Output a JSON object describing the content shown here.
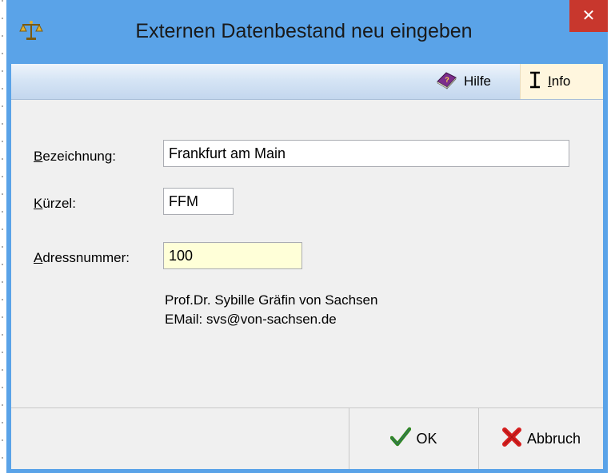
{
  "window": {
    "title": "Externen Datenbestand neu eingeben",
    "close_glyph": "✕",
    "app_icon": "scales-icon",
    "titlebar_color": "#5aa3e8",
    "close_color": "#c8372d"
  },
  "toolbar": {
    "help": {
      "label": "Hilfe",
      "icon": "help-book-icon"
    },
    "info": {
      "prefix": "I",
      "rest": "nfo",
      "icon": "text-cursor-icon"
    }
  },
  "form": {
    "bezeichnung": {
      "label_prefix": "B",
      "label_rest": "ezeichnung:",
      "value": "Frankfurt am Main"
    },
    "kuerzel": {
      "label_prefix": "K",
      "label_rest": "ürzel:",
      "value": "FFM"
    },
    "adressnummer": {
      "label_prefix": "A",
      "label_rest": "dressnummer:",
      "value": "100"
    }
  },
  "contact": {
    "name": "Prof.Dr. Sybille Gräfin von Sachsen",
    "email": "EMail: svs@von-sachsen.de"
  },
  "buttons": {
    "ok": {
      "label": "OK",
      "icon": "checkmark-icon"
    },
    "cancel": {
      "label": "Abbruch",
      "icon": "cross-icon"
    }
  }
}
